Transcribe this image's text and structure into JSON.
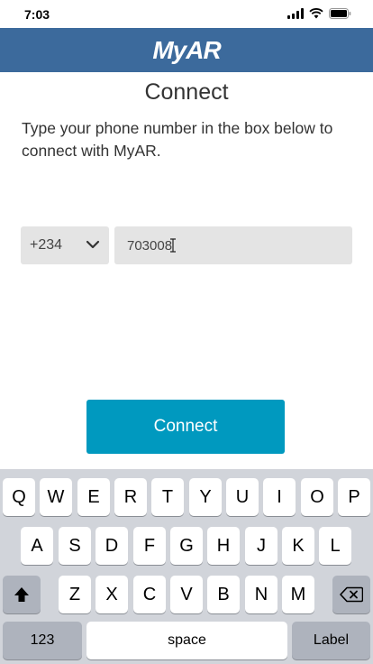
{
  "status_bar": {
    "time": "7:03",
    "icons": [
      "signal-icon",
      "wifi-icon",
      "battery-icon"
    ]
  },
  "header": {
    "logo": "MyAR",
    "background": "#3c6a9c"
  },
  "page": {
    "title": "Connect",
    "instructions": "Type your phone number in the box below to connect with MyAR."
  },
  "form": {
    "country_code": "+234",
    "phone_value": "703008",
    "connect_label": "Connect",
    "button_color": "#0099bf"
  },
  "keyboard": {
    "row1": [
      "Q",
      "W",
      "E",
      "R",
      "T",
      "Y",
      "U",
      "I",
      "O",
      "P"
    ],
    "row2": [
      "A",
      "S",
      "D",
      "F",
      "G",
      "H",
      "J",
      "K",
      "L"
    ],
    "row3": [
      "Z",
      "X",
      "C",
      "V",
      "B",
      "N",
      "M"
    ],
    "numbers_label": "123",
    "space_label": "space",
    "return_label": "Label"
  }
}
